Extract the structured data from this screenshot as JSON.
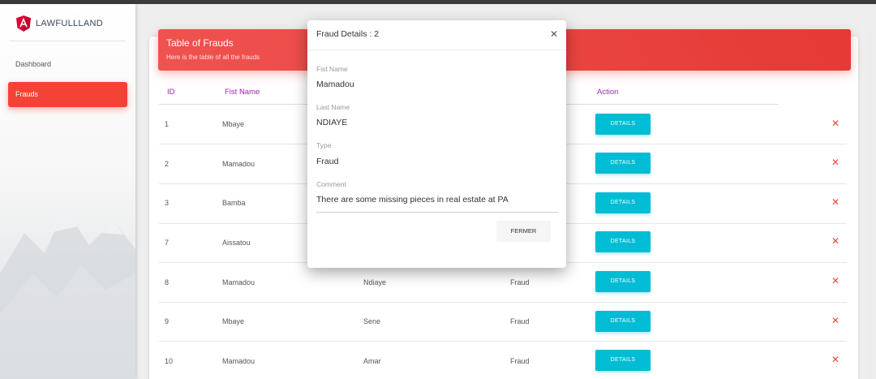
{
  "brand": {
    "name": "LAWFULLLAND"
  },
  "sidebar": {
    "items": [
      {
        "label": "Dashboard"
      },
      {
        "label": "Frauds"
      }
    ]
  },
  "card": {
    "title": "Table of Frauds",
    "subtitle": "Here is the table of all the frauds"
  },
  "table": {
    "headers": {
      "id": "ID",
      "first_name": "Fist Name",
      "action": "Action"
    },
    "details_label": "DETAILS",
    "delete_icon": "close-icon",
    "rows": [
      {
        "id": "1",
        "first_name": "Mbaye",
        "last_name": "",
        "type": ""
      },
      {
        "id": "2",
        "first_name": "Mamadou",
        "last_name": "",
        "type": ""
      },
      {
        "id": "3",
        "first_name": "Bamba",
        "last_name": "",
        "type": ""
      },
      {
        "id": "7",
        "first_name": "Aissatou",
        "last_name": "",
        "type": ""
      },
      {
        "id": "8",
        "first_name": "Mamadou",
        "last_name": "Ndiaye",
        "type": "Fraud"
      },
      {
        "id": "9",
        "first_name": "Mbaye",
        "last_name": "Sene",
        "type": "Fraud"
      },
      {
        "id": "10",
        "first_name": "Mamadou",
        "last_name": "Amar",
        "type": "Fraud"
      }
    ]
  },
  "modal": {
    "title": "Fraud Details : 2",
    "close_icon": "close-icon",
    "fields": [
      {
        "label": "Fist Name",
        "value": "Mamadou"
      },
      {
        "label": "Last Name",
        "value": "NDIAYE"
      },
      {
        "label": "Type",
        "value": "Fraud"
      },
      {
        "label": "Comment",
        "value": "There are some missing pieces in real estate at PA"
      }
    ],
    "close_button": "FERMER"
  },
  "colors": {
    "accent": "#f44336",
    "info": "#00bcd4",
    "header_text": "#9c27b0"
  }
}
